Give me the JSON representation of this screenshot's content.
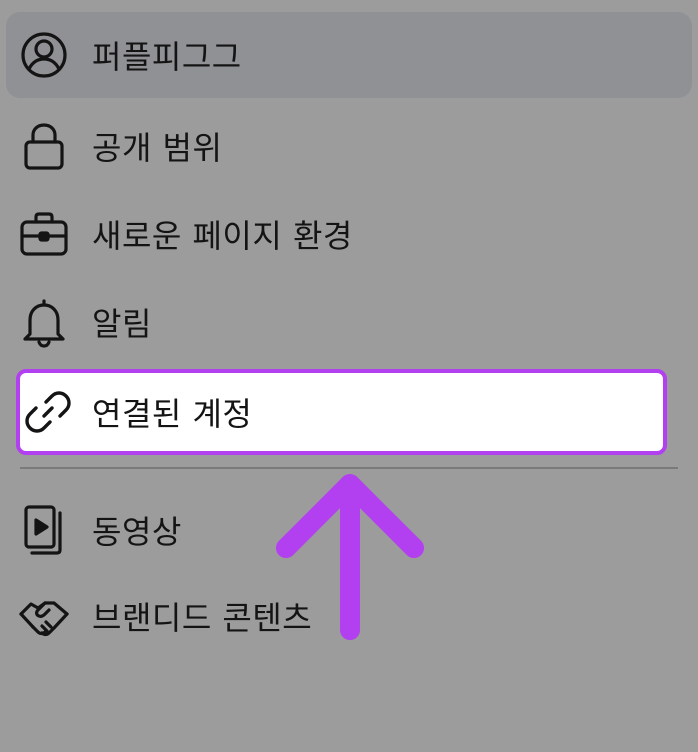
{
  "colors": {
    "background": "#9c9c9c",
    "selected_row": "#8f9194",
    "highlight_border": "#b23ff0",
    "arrow": "#b23ff0",
    "text": "#141414"
  },
  "menu": {
    "items": [
      {
        "label": "퍼플피그그",
        "icon": "person-circle-icon"
      },
      {
        "label": "공개 범위",
        "icon": "lock-icon"
      },
      {
        "label": "새로운 페이지 환경",
        "icon": "briefcase-icon"
      },
      {
        "label": "알림",
        "icon": "bell-icon"
      },
      {
        "label": "연결된 계정",
        "icon": "link-icon"
      },
      {
        "label": "동영상",
        "icon": "video-icon"
      },
      {
        "label": "브랜디드 콘텐츠",
        "icon": "handshake-icon"
      }
    ]
  },
  "annotation": {
    "arrow_icon": "up-arrow-icon"
  }
}
